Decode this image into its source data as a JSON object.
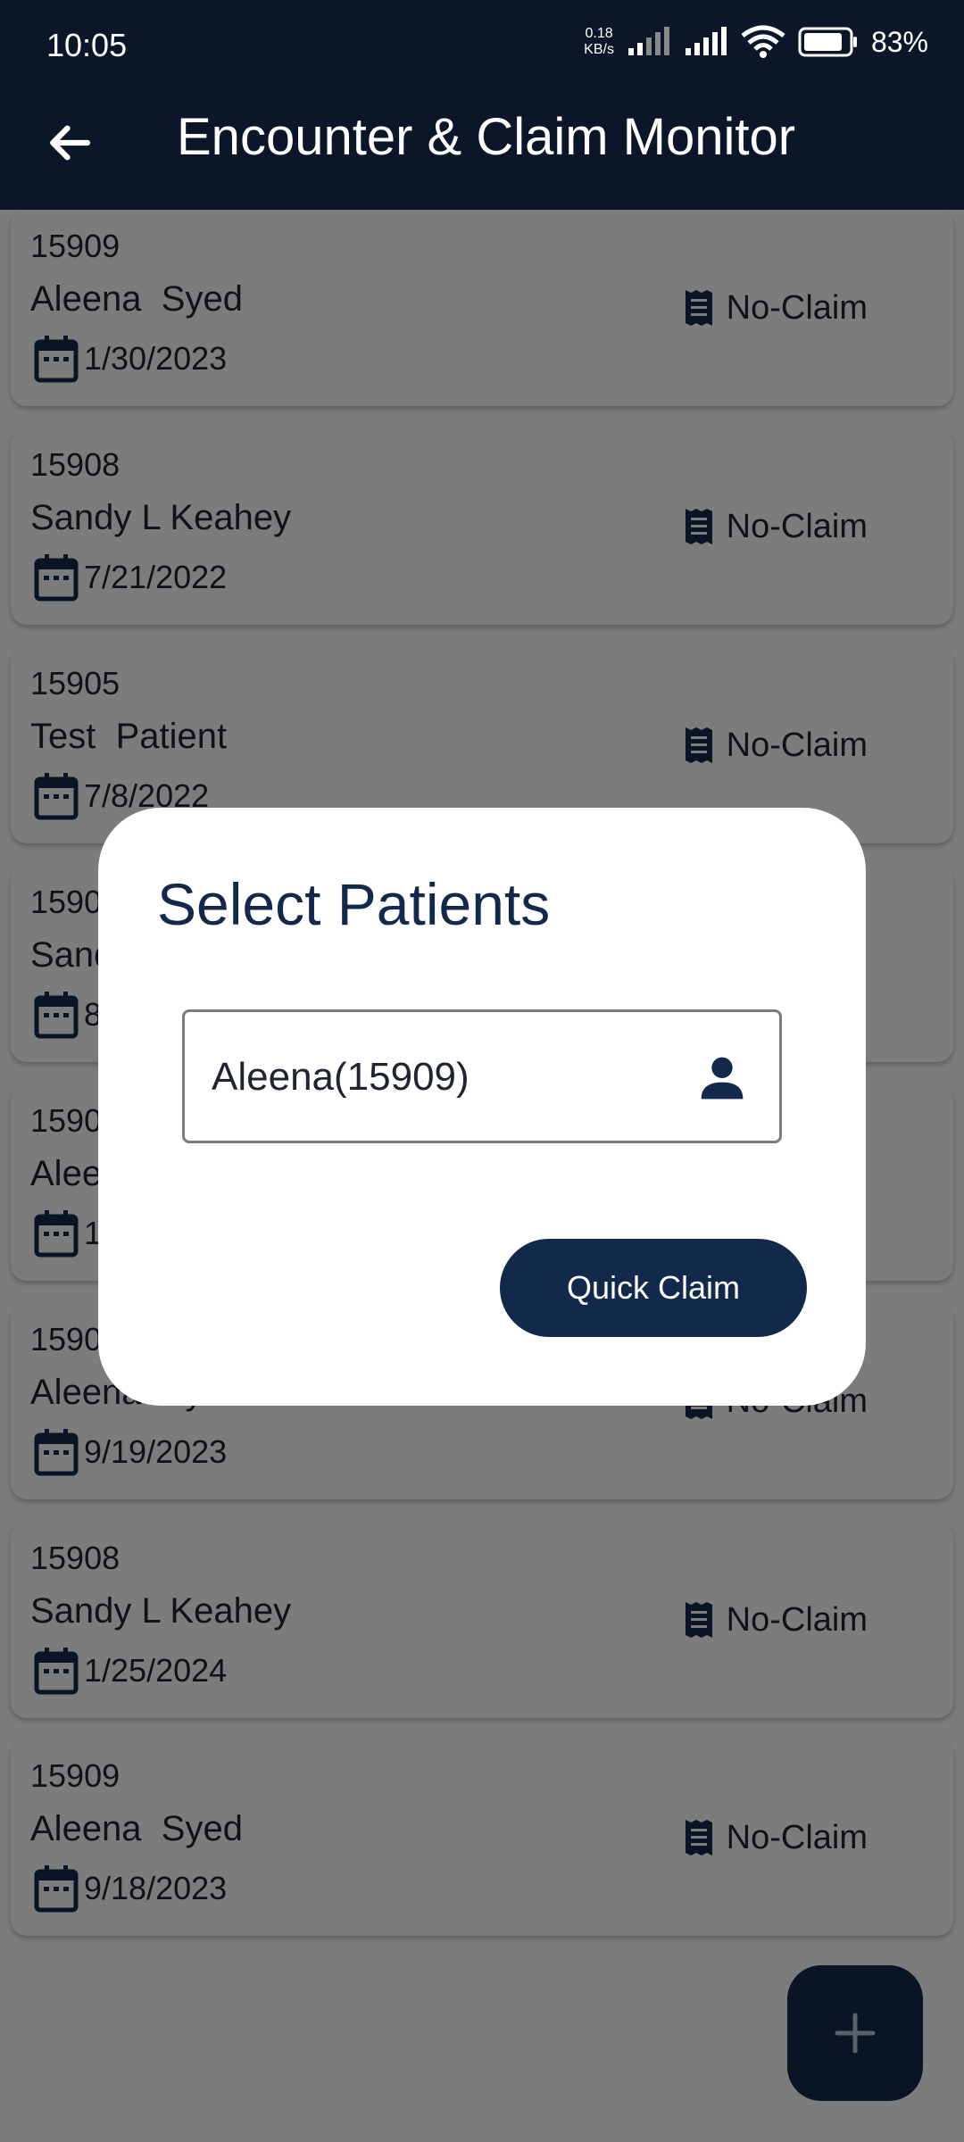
{
  "status_bar": {
    "time": "10:05",
    "net_speed_value": "0.18",
    "net_speed_unit": "KB/s",
    "battery": "83%"
  },
  "app_bar": {
    "title": "Encounter & Claim Monitor"
  },
  "encounters": [
    {
      "id": "15909",
      "name": "Aleena  Syed",
      "date": "1/30/2023",
      "status": "No-Claim"
    },
    {
      "id": "15908",
      "name": "Sandy L Keahey",
      "date": "7/21/2022",
      "status": "No-Claim"
    },
    {
      "id": "15905",
      "name": "Test  Patient",
      "date": "7/8/2022",
      "status": "No-Claim"
    },
    {
      "id": "1590",
      "name": "Sand",
      "date": "8",
      "status": ""
    },
    {
      "id": "1590",
      "name": "Alee",
      "date": "1",
      "status": ""
    },
    {
      "id": "1590",
      "name": "Aleena  Syed",
      "date": "9/19/2023",
      "status": "No-Claim"
    },
    {
      "id": "15908",
      "name": "Sandy L Keahey",
      "date": "1/25/2024",
      "status": "No-Claim"
    },
    {
      "id": "15909",
      "name": "Aleena  Syed",
      "date": "9/18/2023",
      "status": "No-Claim"
    }
  ],
  "dialog": {
    "title": "Select Patients",
    "patient_value": "Aleena(15909)",
    "button_label": "Quick Claim"
  },
  "fab": {
    "icon": "plus-icon"
  },
  "colors": {
    "app_bar": "#0b1729",
    "primary": "#13294b",
    "card_bg": "#fbf8fb"
  }
}
